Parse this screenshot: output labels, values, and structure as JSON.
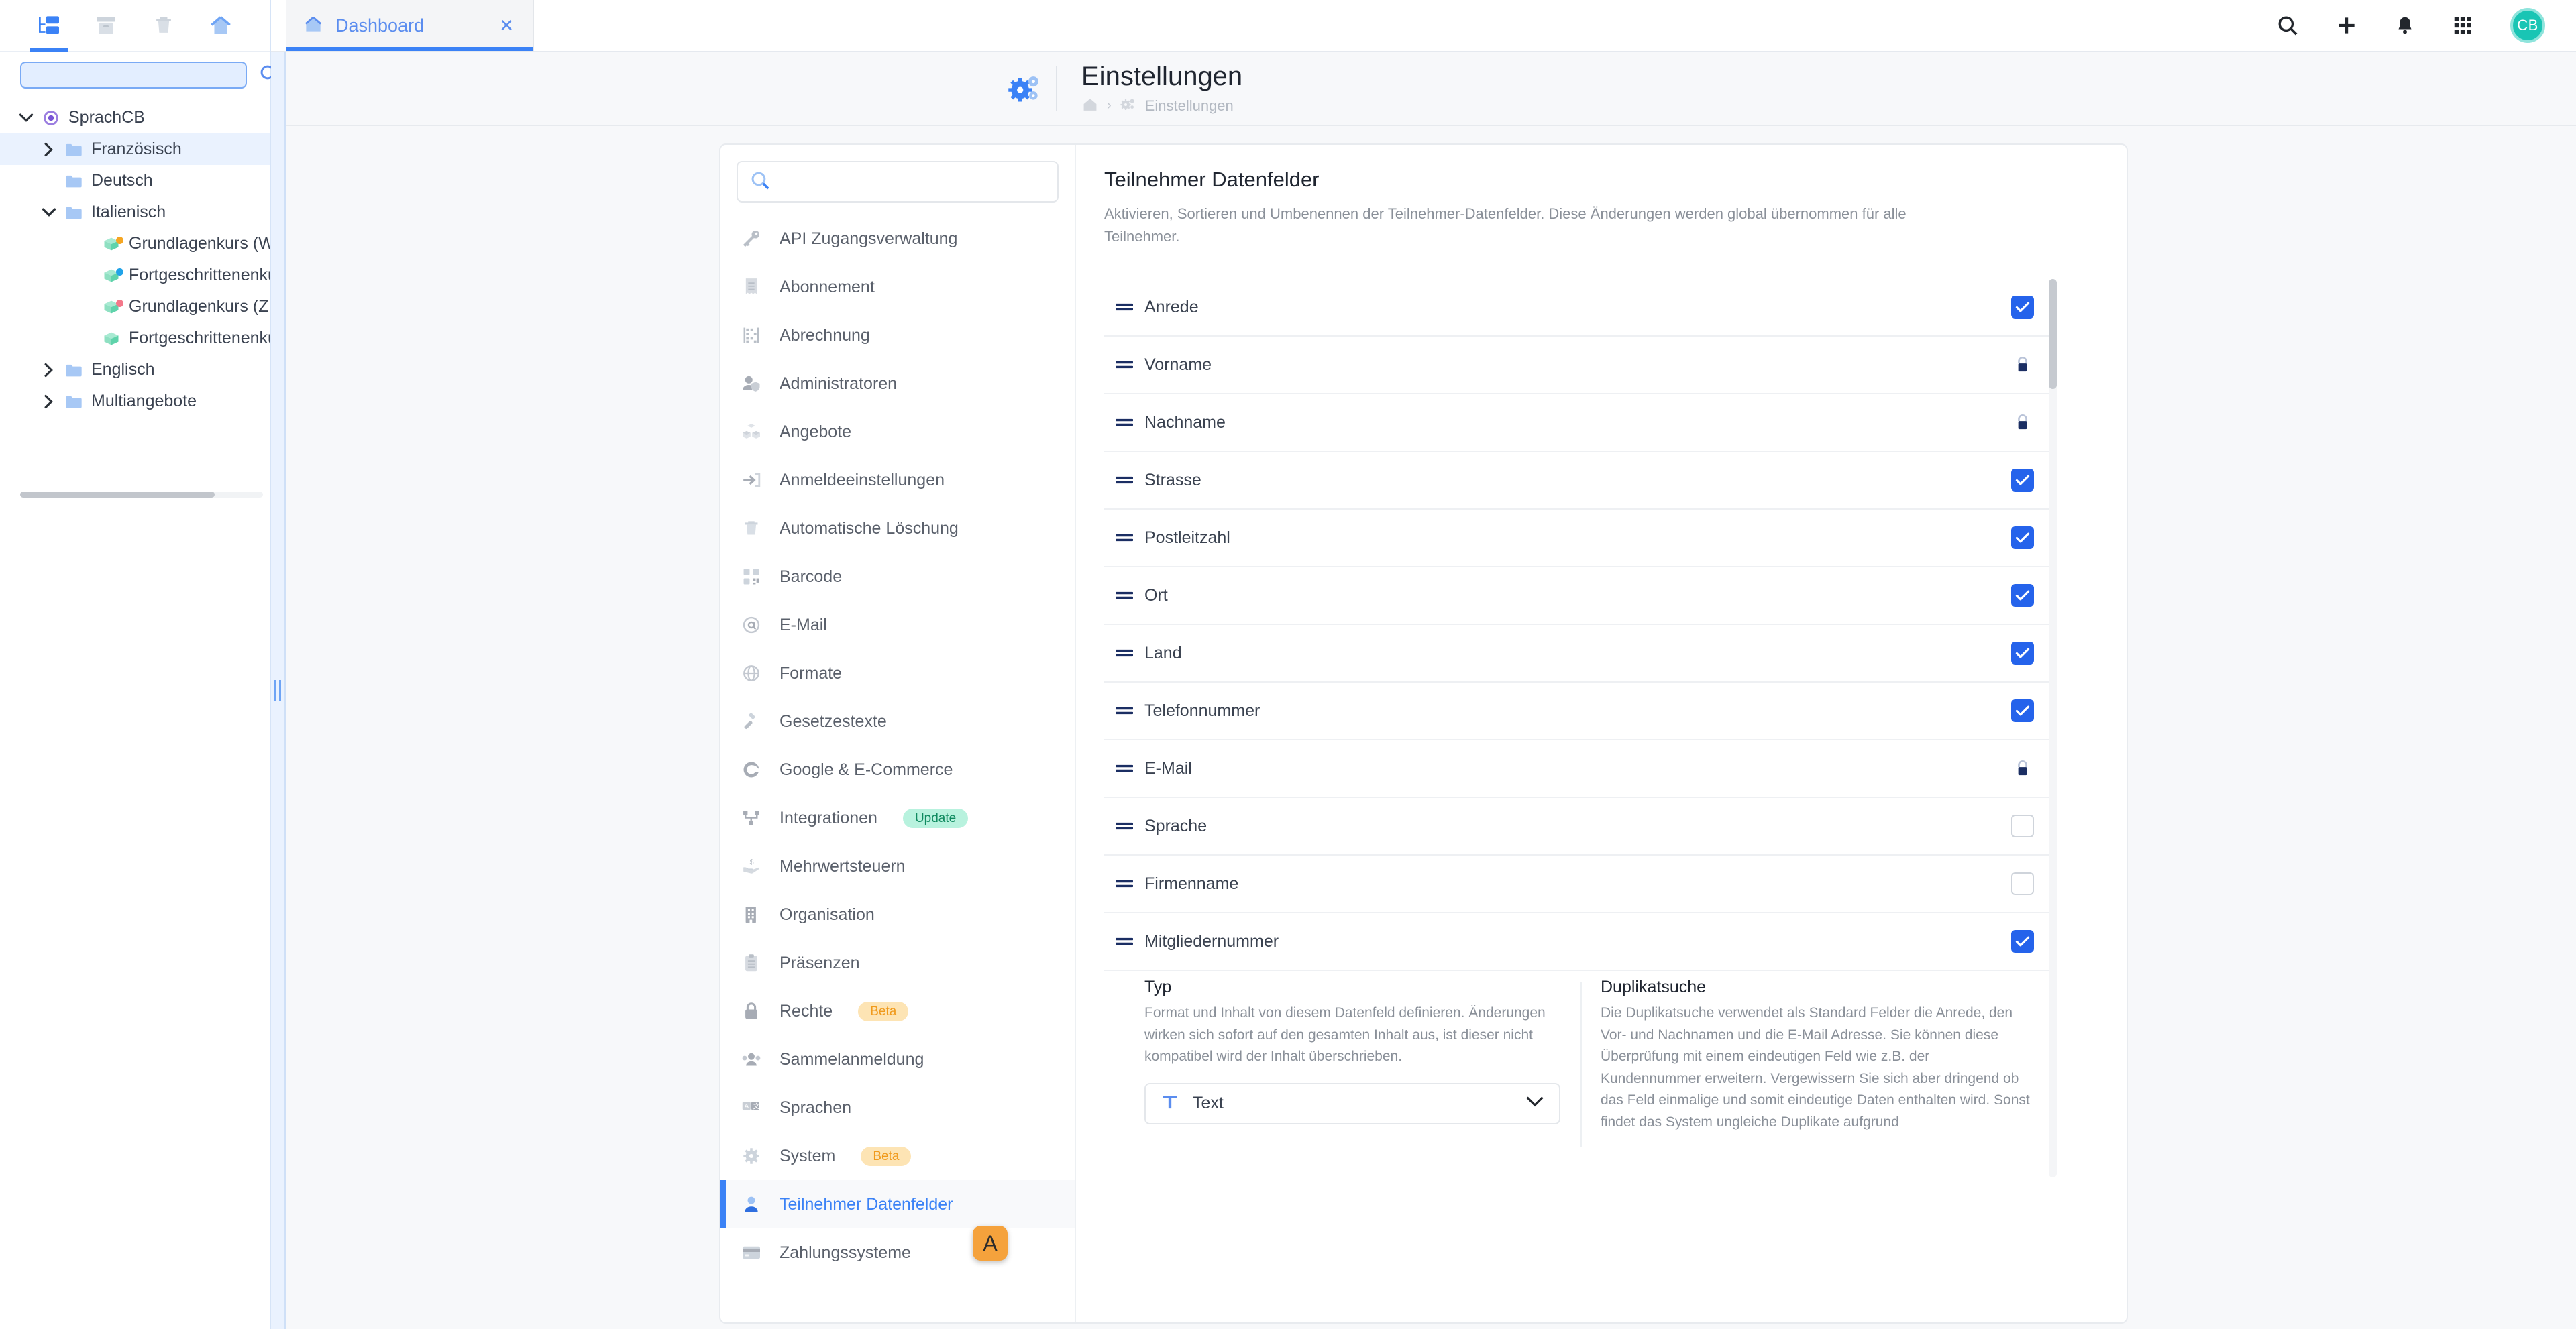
{
  "tree_panel": {
    "toolbar": [
      {
        "name": "folder-tree-icon",
        "label": "Struktur",
        "active": true
      },
      {
        "name": "archive-icon",
        "label": "Archiv",
        "active": false
      },
      {
        "name": "trash-icon",
        "label": "Papierkorb",
        "active": false
      },
      {
        "name": "home-icon",
        "label": "Start",
        "active": false
      }
    ],
    "search": {
      "value": "",
      "placeholder": ""
    },
    "search_icon": "search-icon",
    "items": [
      {
        "label": "SprachCB",
        "level": 0,
        "icon": "target-icon",
        "expander": "down",
        "selected": false
      },
      {
        "label": "Französisch",
        "level": 1,
        "icon": "folder-icon",
        "expander": "right",
        "selected": true
      },
      {
        "label": "Deutsch",
        "level": 1,
        "icon": "folder-icon",
        "expander": "none",
        "selected": false
      },
      {
        "label": "Italienisch",
        "level": 1,
        "icon": "folder-icon",
        "expander": "down",
        "selected": false
      },
      {
        "label": "Grundlagenkurs (Wien",
        "level": 2,
        "icon": "course-box-icon",
        "dot": "#f5a623",
        "expander": "none",
        "selected": false
      },
      {
        "label": "Fortgeschrittenenkurs",
        "level": 2,
        "icon": "course-box-icon",
        "dot": "#21a3e8",
        "expander": "none",
        "selected": false
      },
      {
        "label": "Grundlagenkurs (Züric",
        "level": 2,
        "icon": "course-box-icon",
        "dot": "#f4788a",
        "expander": "none",
        "selected": false
      },
      {
        "label": "Fortgeschrittenenkurs",
        "level": 2,
        "icon": "course-box-icon",
        "dot": "",
        "expander": "none",
        "selected": false
      },
      {
        "label": "Englisch",
        "level": 1,
        "icon": "folder-icon",
        "expander": "right",
        "selected": false
      },
      {
        "label": "Multiangebote",
        "level": 1,
        "icon": "folder-icon",
        "expander": "right",
        "selected": false
      }
    ]
  },
  "topbar": {
    "tabs": [
      {
        "label": "Dashboard",
        "icon": "home-icon",
        "close": "✕",
        "active": true
      }
    ],
    "actions": [
      {
        "name": "search-icon"
      },
      {
        "name": "plus-icon"
      },
      {
        "name": "bell-icon"
      },
      {
        "name": "apps-grid-icon"
      }
    ],
    "avatar_initials": "CB"
  },
  "page_header": {
    "icon": "settings-gears-icon",
    "title": "Einstellungen",
    "breadcrumb": [
      {
        "type": "icon",
        "name": "home-icon"
      },
      {
        "type": "sep",
        "label": "›"
      },
      {
        "type": "icon",
        "name": "settings-gears-icon"
      },
      {
        "type": "text",
        "label": "Einstellungen"
      }
    ]
  },
  "settings_menu": {
    "search": {
      "value": "",
      "placeholder": ""
    },
    "items": [
      {
        "label": "API Zugangsverwaltung",
        "icon": "key-icon",
        "badge": null,
        "active": false
      },
      {
        "label": "Abonnement",
        "icon": "receipt-icon",
        "badge": null,
        "active": false
      },
      {
        "label": "Abrechnung",
        "icon": "abacus-icon",
        "badge": null,
        "active": false
      },
      {
        "label": "Administratoren",
        "icon": "user-shield-icon",
        "badge": null,
        "active": false
      },
      {
        "label": "Angebote",
        "icon": "boxes-icon",
        "badge": null,
        "active": false
      },
      {
        "label": "Anmeldeeinstellungen",
        "icon": "login-arrow-icon",
        "badge": null,
        "active": false
      },
      {
        "label": "Automatische Löschung",
        "icon": "trash-icon",
        "badge": null,
        "active": false
      },
      {
        "label": "Barcode",
        "icon": "qrcode-icon",
        "badge": null,
        "active": false
      },
      {
        "label": "E-Mail",
        "icon": "at-icon",
        "badge": null,
        "active": false
      },
      {
        "label": "Formate",
        "icon": "globe-icon",
        "badge": null,
        "active": false
      },
      {
        "label": "Gesetzestexte",
        "icon": "gavel-icon",
        "badge": null,
        "active": false
      },
      {
        "label": "Google & E-Commerce",
        "icon": "google-g-icon",
        "badge": null,
        "active": false
      },
      {
        "label": "Integrationen",
        "icon": "nodes-icon",
        "badge": {
          "text": "Update",
          "kind": "update"
        },
        "active": false
      },
      {
        "label": "Mehrwertsteuern",
        "icon": "hand-money-icon",
        "badge": null,
        "active": false
      },
      {
        "label": "Organisation",
        "icon": "building-icon",
        "badge": null,
        "active": false
      },
      {
        "label": "Präsenzen",
        "icon": "clipboard-icon",
        "badge": null,
        "active": false
      },
      {
        "label": "Rechte",
        "icon": "lock-icon",
        "badge": {
          "text": "Beta",
          "kind": "beta"
        },
        "active": false
      },
      {
        "label": "Sammelanmeldung",
        "icon": "group-icon",
        "badge": null,
        "active": false
      },
      {
        "label": "Sprachen",
        "icon": "translate-icon",
        "badge": null,
        "active": false
      },
      {
        "label": "System",
        "icon": "gear-icon",
        "badge": {
          "text": "Beta",
          "kind": "beta"
        },
        "active": false
      },
      {
        "label": "Teilnehmer Datenfelder",
        "icon": "user-icon",
        "badge": null,
        "active": true
      },
      {
        "label": "Zahlungssysteme",
        "icon": "credit-card-icon",
        "badge": null,
        "active": false
      }
    ]
  },
  "detail": {
    "title": "Teilnehmer Datenfelder",
    "subtitle": "Aktivieren, Sortieren und Umbenennen der Teilnehmer-Datenfelder. Diese Änderungen werden global übernommen für alle Teilnehmer.",
    "fields": [
      {
        "label": "Anrede",
        "state": "checked"
      },
      {
        "label": "Vorname",
        "state": "locked"
      },
      {
        "label": "Nachname",
        "state": "locked"
      },
      {
        "label": "Strasse",
        "state": "checked"
      },
      {
        "label": "Postleitzahl",
        "state": "checked"
      },
      {
        "label": "Ort",
        "state": "checked"
      },
      {
        "label": "Land",
        "state": "checked"
      },
      {
        "label": "Telefonnummer",
        "state": "checked"
      },
      {
        "label": "E-Mail",
        "state": "locked"
      },
      {
        "label": "Sprache",
        "state": "unchecked"
      },
      {
        "label": "Firmenname",
        "state": "unchecked"
      },
      {
        "label": "Mitgliedernummer",
        "state": "checked"
      }
    ],
    "expanded": {
      "typ": {
        "title": "Typ",
        "text": "Format und Inhalt von diesem Datenfeld definieren. Änderungen wirken sich sofort auf den gesamten Inhalt aus, ist dieser nicht kompatibel wird der Inhalt überschrieben.",
        "select_icon": "text-type-icon",
        "select_value": "Text",
        "chevron": "chevron-down-icon"
      },
      "duplikatsuche": {
        "title": "Duplikatsuche",
        "text": "Die Duplikatsuche verwendet als Standard Felder die Anrede, den Vor- und Nachnamen und die E-Mail Adresse. Sie können diese Überprüfung mit einem eindeutigen Feld wie z.B. der Kundennummer erweitern. Vergewissern Sie sich aber dringend ob das Feld einmalige und somit eindeutige Daten enthalten wird. Sonst findet das System ungleiche Duplikate aufgrund"
      }
    }
  },
  "hint_marker": {
    "label": "A"
  },
  "colors": {
    "accent_blue": "#3b82f6",
    "checkbox_blue": "#2563eb",
    "lock_navy": "#1b2e63",
    "avatar_teal": "#19c5b4",
    "badge_update_bg": "#b8f2de",
    "badge_beta_bg": "#fde4b4",
    "marker_orange": "#f5a23c"
  }
}
